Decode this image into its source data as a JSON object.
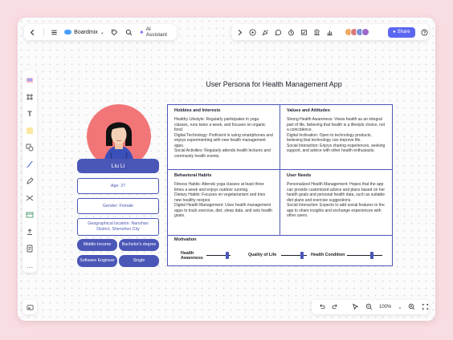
{
  "topbar": {
    "app_name": "Boardmix",
    "ai_label": "AI Assistant",
    "share_label": "Share"
  },
  "bottombar": {
    "zoom": "100%"
  },
  "colors": {
    "accent": "#4a57b7",
    "portrait_bg": "#f27677",
    "frame_bg": "#f8dde2",
    "share_bg": "#5b67f0"
  },
  "persona": {
    "title": "User Persona for Health Management App",
    "name": "Liu Li",
    "age": "Age: 27",
    "gender": "Gender: Female",
    "location": "Geographical location: Nanshan District, Shenzhen City",
    "tags": [
      "Middle-Income",
      "Bachelor's degree",
      "Software Engineer",
      "Single"
    ]
  },
  "sections": {
    "hobbies": {
      "title": "Hobbies and Interests",
      "body": "Healthy Lifestyle: Regularly participates in yoga classes, runs twice a week, and focuses on organic food.\nDigital Technology: Proficient in using smartphones and enjoys experimenting with new health management apps.\nSocial Activities: Regularly attends health lectures and community health events."
    },
    "values": {
      "title": "Values and Attitudes",
      "body": "Strong Health Awareness: Views health as an integral part of life, believing that health is a lifestyle choice, not a coincidence.\nDigital Inclination: Open to technology products, believing that technology can improve life.\nSocial Interaction: Enjoys sharing experiences, seeking support, and advice with other health enthusiasts."
    },
    "behavioral": {
      "title": "Behavioral Habits",
      "body": "Fitness Habits: Attends yoga classes at least three times a week and enjoys outdoor running.\nDietary Habits: Focuses on vegetarianism and tries new healthy recipes.\nDigital Health Management: Uses health management apps to track exercise, diet, sleep data, and sets health goals."
    },
    "needs": {
      "title": "User Needs",
      "body": "Personalized Health Management: Hopes that the app can provide customized advice and plans based on her health goals and personal health data, such as suitable diet plans and exercise suggestions.\nSocial Interaction: Expects to add social features to the app to share insights and exchange experiences with other users."
    },
    "motivation": {
      "title": "Motivation",
      "items": [
        {
          "label": "Health Awareness",
          "level": 0.85
        },
        {
          "label": "Quality of Life",
          "level": 0.8
        },
        {
          "label": "Health Condition",
          "level": 0.7
        }
      ]
    }
  }
}
